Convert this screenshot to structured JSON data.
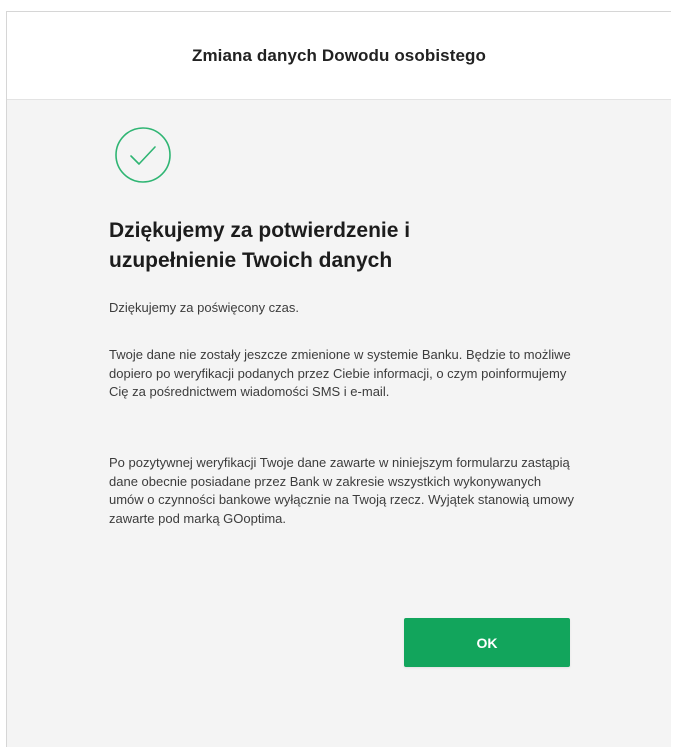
{
  "dialog": {
    "title": "Zmiana danych Dowodu osobistego",
    "success_icon": "check-circle-icon",
    "heading": "Dziękujemy za potwierdzenie i uzupełnienie Twoich danych",
    "paragraphs": [
      "Dziękujemy za poświęcony czas.",
      "Twoje dane nie zostały jeszcze zmienione w systemie Banku. Będzie to możliwe dopiero po weryfikacji podanych przez Ciebie informacji, o czym poinformujemy Cię za pośrednictwem wiadomości SMS i e-mail.",
      "Po pozytywnej weryfikacji Twoje dane zawarte w niniejszym formularzu zastąpią dane obecnie posiadane przez Bank w zakresie wszystkich wykonywanych umów o czynności bankowe wyłącznie na Twoją rzecz. Wyjątek stanowią umowy zawarte pod marką GOoptima."
    ],
    "ok_label": "OK"
  },
  "colors": {
    "accent": "#12a55c",
    "icon_stroke": "#2fb573",
    "background": "#f4f4f4"
  }
}
